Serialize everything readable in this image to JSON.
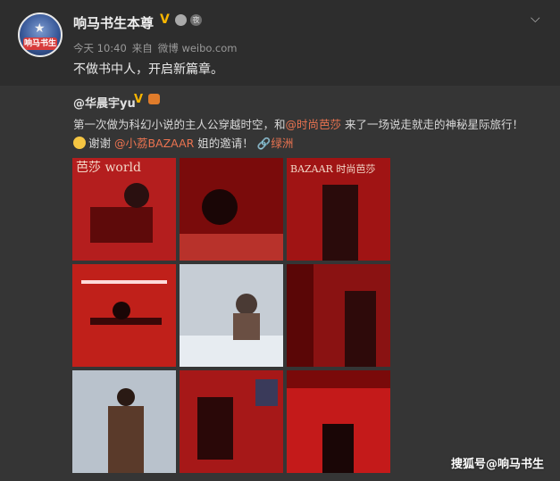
{
  "post": {
    "username": "响马书生本尊",
    "time": "今天 10:40",
    "source_prefix": "来自",
    "source": "微博 weibo.com",
    "status": "不做书中人，开启新篇章。",
    "avatar_text": "响马书生"
  },
  "repost": {
    "author": "@华晨宇yu",
    "line1_pre": "第一次做为科幻小说的主人公穿越时空，和",
    "line1_mention": "@时尚芭莎",
    "line1_post": " 来了一场说走就走的神秘星际旅行！",
    "line2_pre": "谢谢 ",
    "line2_mention": "@小荔BAZAAR",
    "line2_post": " 姐的邀请！",
    "location_icon": "link-icon",
    "location": "绿洲"
  },
  "photos": [
    {
      "name": "photo-1",
      "bg": "#b41e1e",
      "caption": "芭莎 world"
    },
    {
      "name": "photo-2",
      "bg": "#7a0b0b",
      "caption": ""
    },
    {
      "name": "photo-3",
      "bg": "#a01414",
      "caption": "BAZAAR 时尚芭莎"
    },
    {
      "name": "photo-4",
      "bg": "#c0201a",
      "caption": ""
    },
    {
      "name": "photo-5",
      "bg": "#c6cdd5",
      "caption": ""
    },
    {
      "name": "photo-6",
      "bg": "#8a1212",
      "caption": ""
    },
    {
      "name": "photo-7",
      "bg": "#b9c2cc",
      "caption": ""
    },
    {
      "name": "photo-8",
      "bg": "#a61818",
      "caption": ""
    },
    {
      "name": "photo-9",
      "bg": "#c41a1a",
      "caption": ""
    }
  ],
  "watermark": "搜狐号@响马书生",
  "colors": {
    "accent": "#eb7350",
    "vip": "#f7b500"
  }
}
